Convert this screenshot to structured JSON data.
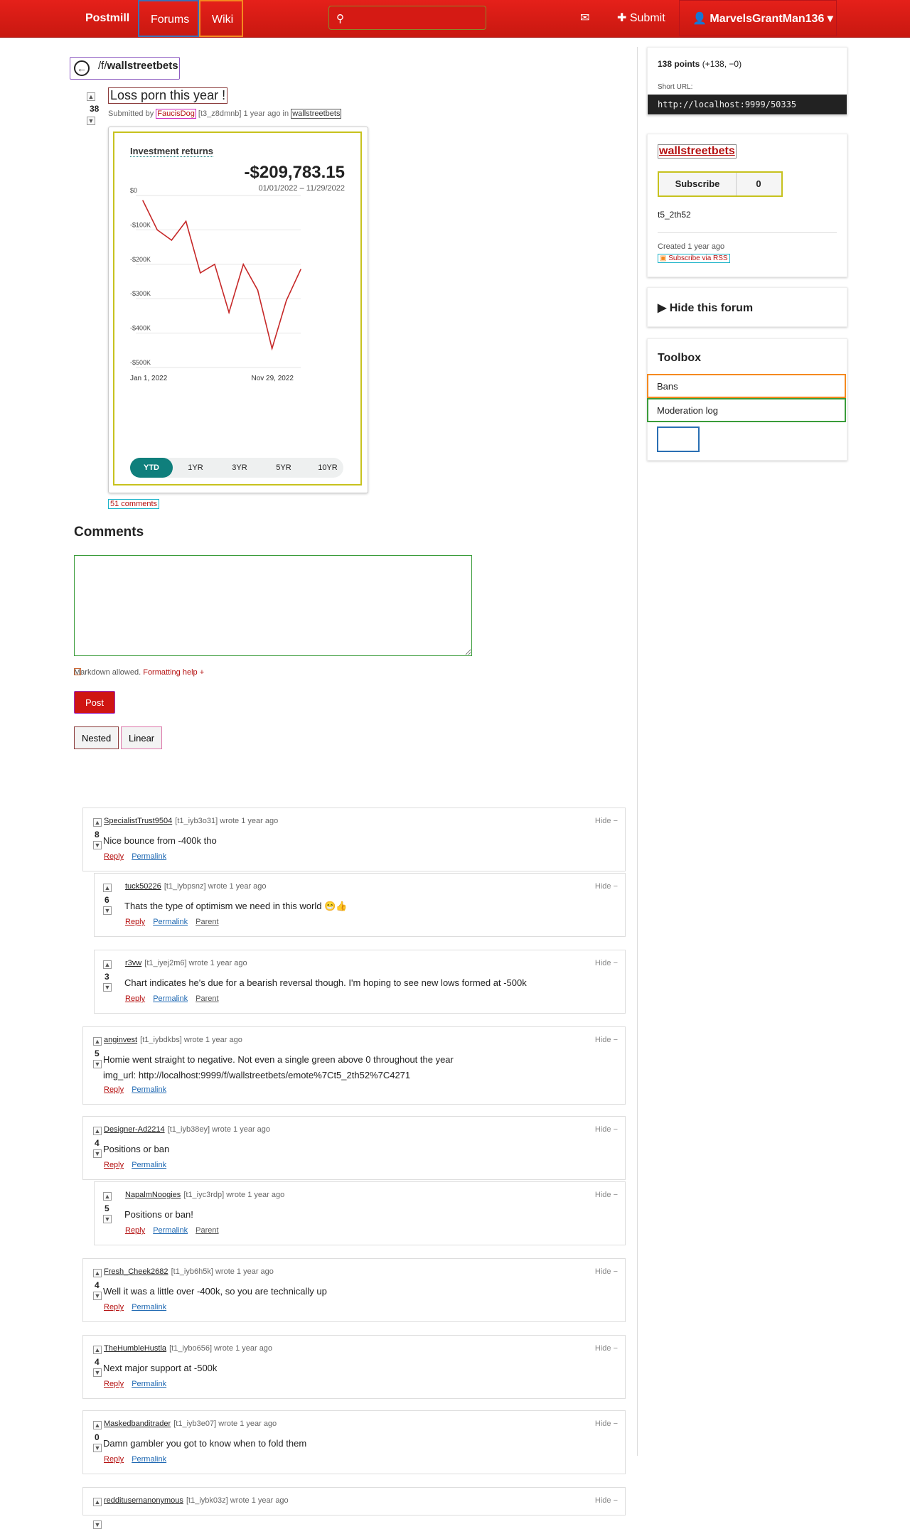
{
  "nav": {
    "brand": "Postmill",
    "forums": "Forums",
    "wiki": "Wiki",
    "search_placeholder": "",
    "submit": "Submit",
    "user": "MarvelsGrantMan136 ▾"
  },
  "forum": {
    "prefix": "/f/",
    "name": "wallstreetbets"
  },
  "post": {
    "title": "Loss porn this year !",
    "score": "38",
    "submitted_by": "Submitted by",
    "author": "FaucisDog",
    "author_id": "[t3_z8dmnb]",
    "age_in": "1 year ago in",
    "forum": "wallstreetbets",
    "comment_count": "51 comments"
  },
  "chart_data": {
    "type": "line",
    "title": "Investment returns",
    "headline_value": "-$209,783.15",
    "date_range": "01/01/2022 – 11/29/2022",
    "x_labels": [
      "Jan 1, 2022",
      "Nov 29, 2022"
    ],
    "y_ticks": [
      "$0",
      "-$100K",
      "-$200K",
      "-$300K",
      "-$400K",
      "-$500K"
    ],
    "ylim": [
      -500000,
      0
    ],
    "values": [
      -15000,
      -100000,
      -130000,
      -75000,
      -225000,
      -200000,
      -340000,
      -200000,
      -275000,
      -445000,
      -305000,
      -215000
    ],
    "ranges": [
      "YTD",
      "1YR",
      "3YR",
      "5YR",
      "10YR"
    ],
    "active_range": "YTD",
    "line_color": "#c62828",
    "accent": "#0f7f7c"
  },
  "comments_section": {
    "heading": "Comments",
    "markdown_note": "Markdown allowed.",
    "formatting_help": "Formatting help +",
    "post_button": "Post",
    "nested": "Nested",
    "linear": "Linear"
  },
  "comments": [
    {
      "user": "SpecialistTrust9504",
      "id": "[t1_iyb3o31]",
      "meta": "wrote 1 year ago",
      "score": "8",
      "body": "Nice bounce from -400k tho",
      "reply": "Reply",
      "permalink": "Permalink",
      "parent": "",
      "hide": "Hide −"
    },
    {
      "user": "tuck50226",
      "id": "[t1_iybpsnz]",
      "meta": "wrote 1 year ago",
      "score": "6",
      "body": "Thats the type of optimism we need in this world 😁👍",
      "reply": "Reply",
      "permalink": "Permalink",
      "parent": "Parent",
      "hide": "Hide −"
    },
    {
      "user": "r3vw",
      "id": "[t1_iyej2m6]",
      "meta": "wrote 1 year ago",
      "score": "3",
      "body": "Chart indicates he's due for a bearish reversal though. I'm hoping to see new lows formed at -500k",
      "reply": "Reply",
      "permalink": "Permalink",
      "parent": "Parent",
      "hide": "Hide −"
    },
    {
      "user": "anginvest",
      "id": "[t1_iybdkbs]",
      "meta": "wrote 1 year ago",
      "score": "5",
      "body": "Homie went straight to negative. Not even a single green above 0 throughout the year",
      "body2": "img_url: http://localhost:9999/f/wallstreetbets/emote%7Ct5_2th52%7C4271",
      "reply": "Reply",
      "permalink": "Permalink",
      "parent": "",
      "hide": "Hide −"
    },
    {
      "user": "Designer-Ad2214",
      "id": "[t1_iyb38ey]",
      "meta": "wrote 1 year ago",
      "score": "4",
      "body": "Positions or ban",
      "reply": "Reply",
      "permalink": "Permalink",
      "parent": "",
      "hide": "Hide −"
    },
    {
      "user": "NapalmNoogies",
      "id": "[t1_iyc3rdp]",
      "meta": "wrote 1 year ago",
      "score": "5",
      "body": "Positions or ban!",
      "reply": "Reply",
      "permalink": "Permalink",
      "parent": "Parent",
      "hide": "Hide −"
    },
    {
      "user": "Fresh_Cheek2682",
      "id": "[t1_iyb6h5k]",
      "meta": "wrote 1 year ago",
      "score": "4",
      "body": "Well it was a little over -400k, so you are technically up",
      "reply": "Reply",
      "permalink": "Permalink",
      "parent": "",
      "hide": "Hide −"
    },
    {
      "user": "TheHumbleHustla",
      "id": "[t1_iybo656]",
      "meta": "wrote 1 year ago",
      "score": "4",
      "body": "Next major support at -500k",
      "reply": "Reply",
      "permalink": "Permalink",
      "parent": "",
      "hide": "Hide −"
    },
    {
      "user": "Maskedbanditrader",
      "id": "[t1_iyb3e07]",
      "meta": "wrote 1 year ago",
      "score": "0",
      "body": "Damn gambler you got to know when to fold them",
      "reply": "Reply",
      "permalink": "Permalink",
      "parent": "",
      "hide": "Hide −"
    },
    {
      "user": "redditusernanonymous",
      "id": "[t1_iybk03z]",
      "meta": "wrote 1 year ago",
      "score": "",
      "body": "",
      "reply": "",
      "permalink": "",
      "parent": "",
      "hide": "Hide −"
    }
  ],
  "sidebar": {
    "points": "138 points",
    "points_detail": "(+138, −0)",
    "short_url_label": "Short URL:",
    "short_url": "http://localhost:9999/50335",
    "forum_name": "wallstreetbets",
    "subscribe": "Subscribe",
    "subscriber_count": "0",
    "forum_id": "t5_2th52",
    "created": "Created 1 year ago",
    "rss": "Subscribe via RSS",
    "hide_forum": "▶ Hide this forum",
    "toolbox": "Toolbox",
    "bans": "Bans",
    "moderation_log": "Moderation log"
  }
}
